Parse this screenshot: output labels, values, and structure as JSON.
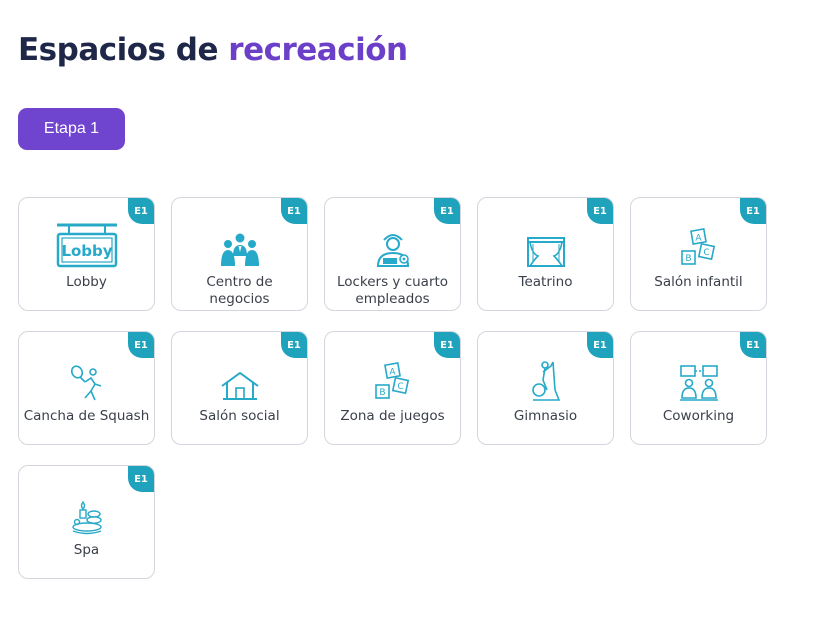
{
  "header": {
    "title_main": "Espacios de ",
    "title_accent": "recreación"
  },
  "stage_button": {
    "label": "Etapa 1"
  },
  "colors": {
    "accent": "#6f44cf",
    "icon": "#27a9c9",
    "badge": "#1fa3bd",
    "title": "#1f2748"
  },
  "spaces": [
    {
      "label": "Lobby",
      "badge": "E1",
      "icon": "lobby-sign-icon"
    },
    {
      "label": "Centro de negocios",
      "badge": "E1",
      "icon": "business-people-icon"
    },
    {
      "label": "Lockers y cuarto empleados",
      "badge": "E1",
      "icon": "employee-icon"
    },
    {
      "label": "Teatrino",
      "badge": "E1",
      "icon": "theater-curtain-icon"
    },
    {
      "label": "Salón infantil",
      "badge": "E1",
      "icon": "abc-blocks-icon"
    },
    {
      "label": "Cancha de Squash",
      "badge": "E1",
      "icon": "squash-player-icon"
    },
    {
      "label": "Salón social",
      "badge": "E1",
      "icon": "house-icon"
    },
    {
      "label": "Zona de juegos",
      "badge": "E1",
      "icon": "abc-blocks-icon"
    },
    {
      "label": "Gimnasio",
      "badge": "E1",
      "icon": "elliptical-machine-icon"
    },
    {
      "label": "Coworking",
      "badge": "E1",
      "icon": "coworking-people-icon"
    },
    {
      "label": "Spa",
      "badge": "E1",
      "icon": "spa-stones-icon"
    }
  ]
}
